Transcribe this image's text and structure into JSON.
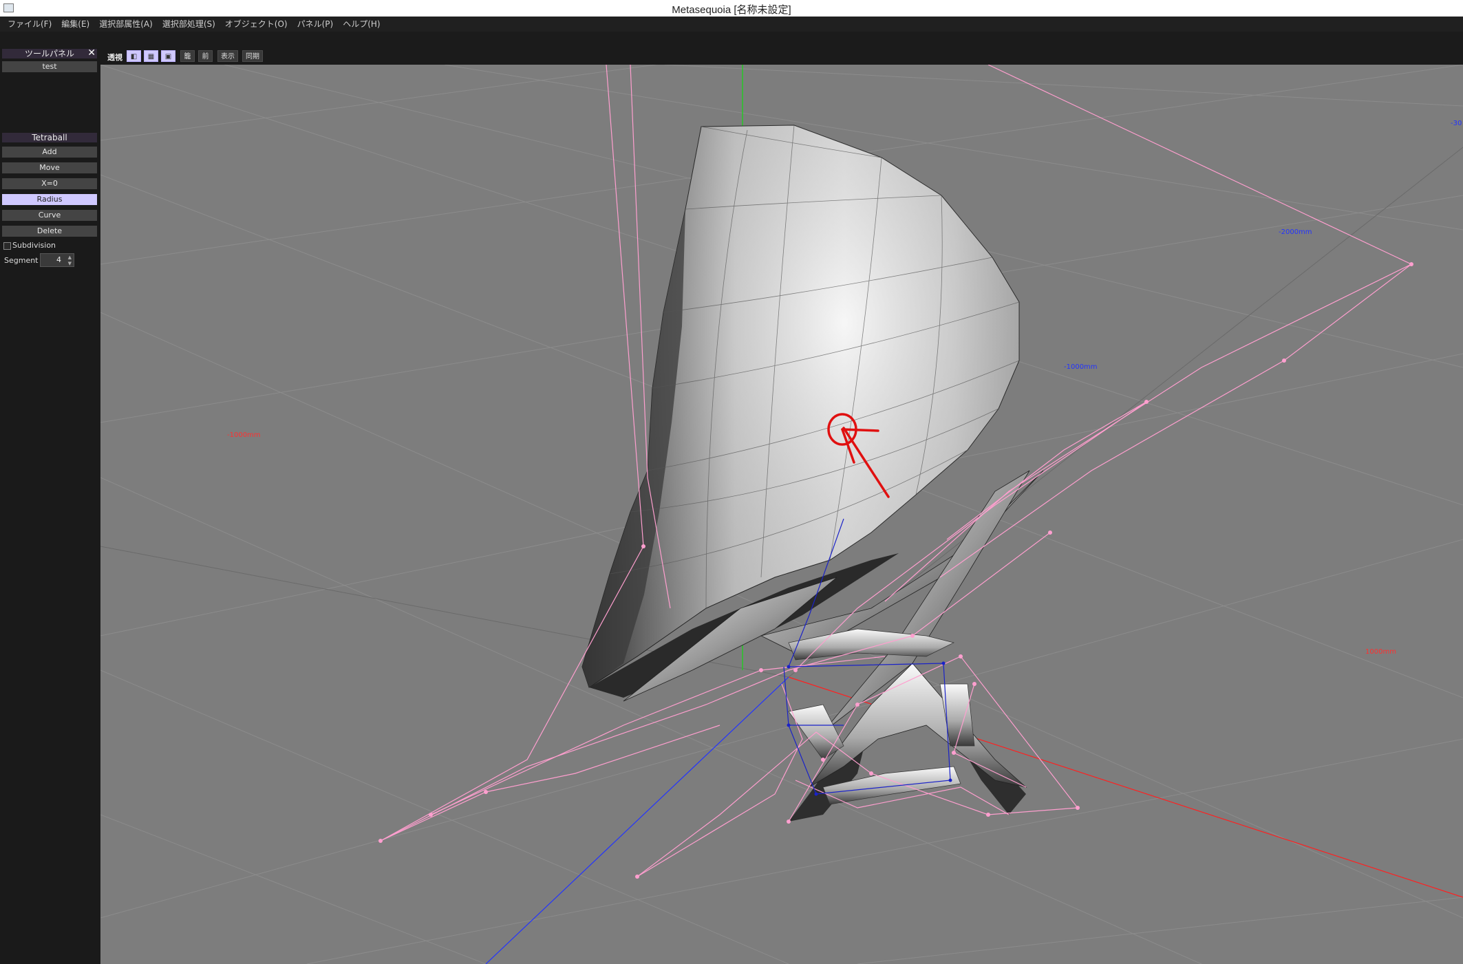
{
  "window": {
    "title": "Metasequoia [名称未設定]"
  },
  "menu": [
    {
      "label": "ファイル(F)"
    },
    {
      "label": "編集(E)"
    },
    {
      "label": "選択部属性(A)"
    },
    {
      "label": "選択部処理(S)"
    },
    {
      "label": "オブジェクト(O)"
    },
    {
      "label": "パネル(P)"
    },
    {
      "label": "ヘルプ(H)"
    }
  ],
  "tool_panel": {
    "title": "ツールパネル",
    "close_glyph": "✕",
    "item": "test"
  },
  "tetraball": {
    "title": "Tetraball",
    "buttons": [
      "Add",
      "Move",
      "X=0",
      "Radius",
      "Curve",
      "Delete"
    ],
    "active": "Radius",
    "subdivision_label": "Subdivision",
    "subdivision_checked": false,
    "segment_label": "Segment",
    "segment_value": "4"
  },
  "viewport_toolbar": {
    "mode_label": "透視",
    "buttons": [
      {
        "label": "",
        "icon": "view-mode-icon",
        "on": true
      },
      {
        "label": "",
        "icon": "view-mode-icon",
        "on": true
      },
      {
        "label": "",
        "icon": "view-mode-icon",
        "on": true
      },
      {
        "label": "籠",
        "on": false
      },
      {
        "label": "前",
        "on": false
      },
      {
        "label": "表示",
        "on": false
      },
      {
        "label": "同期",
        "on": false
      }
    ]
  },
  "viewport": {
    "labels": {
      "x_neg": "-1000mm",
      "x_pos": "1000mm",
      "z_1": "-1000mm",
      "z_2": "-2000mm",
      "z_3": "-30"
    },
    "colors": {
      "background": "#7d7d7d",
      "grid": "#8c8c8c",
      "wire": "#ff9fcf",
      "x_axis": "#ff2020",
      "y_axis": "#22cc22",
      "z_axis": "#2233ff",
      "annotation": "#e01010"
    },
    "icons": [
      "tetraball-model",
      "annotation-circle-arrow"
    ]
  }
}
